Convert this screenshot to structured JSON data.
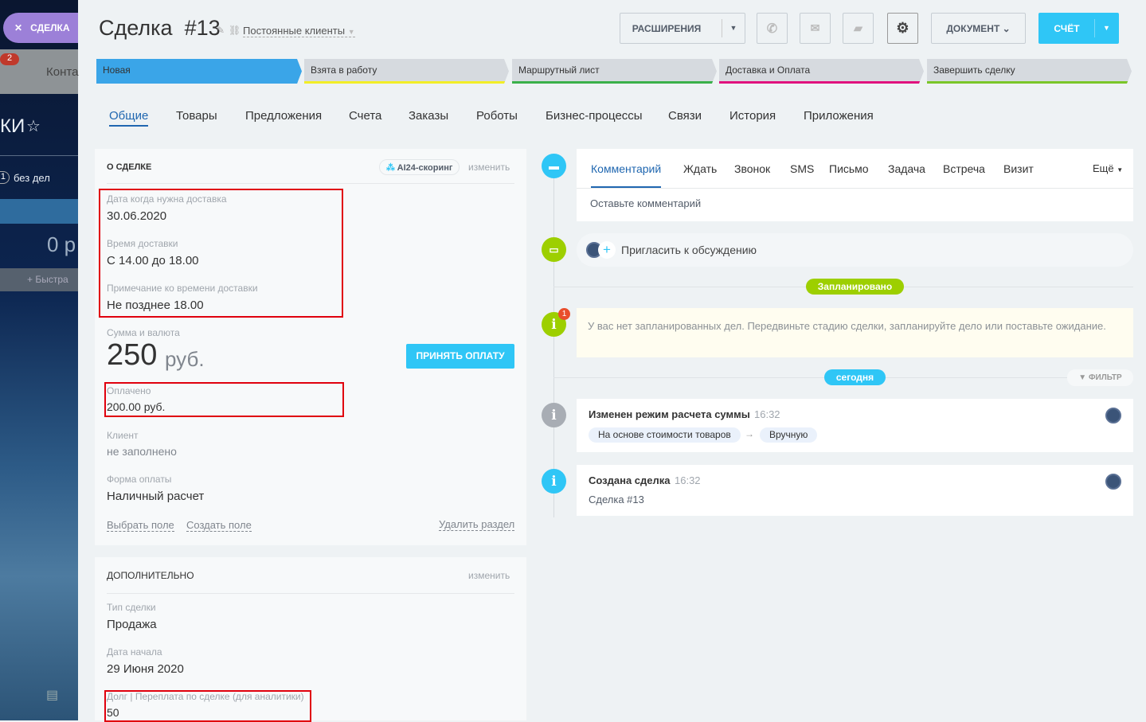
{
  "left_panel": {
    "deal_tab": "СДЕЛКА",
    "badge": "2",
    "contacts": "Конта",
    "title_fragment": "КИ",
    "counter": "1",
    "no_tasks": "без дел",
    "amount": "0 р",
    "quick": "Быстра"
  },
  "header": {
    "title": "Сделка",
    "number": "#13",
    "category": "Постоянные клиенты"
  },
  "toolbar": {
    "extensions": "РАСШИРЕНИЯ",
    "document": "ДОКУМЕНТ",
    "invoice": "СЧЁТ"
  },
  "stages": [
    {
      "label": "Новая",
      "color": "#3aa5e8"
    },
    {
      "label": "Взята в работу",
      "color": "#f2ee26"
    },
    {
      "label": "Маршрутный лист",
      "color": "#3ab04a"
    },
    {
      "label": "Доставка и Оплата",
      "color": "#e0127e"
    },
    {
      "label": "Завершить сделку",
      "color": "#7ac628"
    }
  ],
  "tabs": [
    "Общие",
    "Товары",
    "Предложения",
    "Счета",
    "Заказы",
    "Роботы",
    "Бизнес-процессы",
    "Связи",
    "История",
    "Приложения"
  ],
  "about": {
    "title": "О СДЕЛКЕ",
    "scoring": "AI24-скоринг",
    "edit": "изменить",
    "delivery_date_label": "Дата когда нужна доставка",
    "delivery_date": "30.06.2020",
    "delivery_time_label": "Время доставки",
    "delivery_time": "С 14.00 до 18.00",
    "note_label": "Примечание ко времени доставки",
    "note": "Не позднее 18.00",
    "sum_label": "Сумма и валюта",
    "sum": "250",
    "currency": "руб.",
    "accept_payment": "ПРИНЯТЬ ОПЛАТУ",
    "paid_label": "Оплачено",
    "paid": "200.00 руб.",
    "client_label": "Клиент",
    "client": "не заполнено",
    "payment_form_label": "Форма оплаты",
    "payment_form": "Наличный расчет",
    "select_field": "Выбрать поле",
    "create_field": "Создать поле",
    "delete_section": "Удалить раздел"
  },
  "extra": {
    "title": "ДОПОЛНИТЕЛЬНО",
    "edit": "изменить",
    "type_label": "Тип сделки",
    "type": "Продажа",
    "start_label": "Дата начала",
    "start": "29 Июня 2020",
    "debt_label": "Долг | Переплата по сделке (для аналитики)",
    "debt": "50"
  },
  "timeline": {
    "tabs": [
      "Комментарий",
      "Ждать",
      "Звонок",
      "SMS",
      "Письмо",
      "Задача",
      "Встреча",
      "Визит"
    ],
    "more": "Ещё",
    "comment_placeholder": "Оставьте комментарий",
    "invite": "Пригласить к обсуждению",
    "planned": "Запланировано",
    "badge": "1",
    "no_tasks": "У вас нет запланированных дел. Передвиньте стадию сделки, запланируйте дело или поставьте ожидание.",
    "today": "сегодня",
    "filter": "ФИЛЬТР",
    "events": [
      {
        "title": "Изменен режим расчета суммы",
        "time": "16:32",
        "from": "На основе стоимости товаров",
        "to": "Вручную"
      },
      {
        "title": "Создана сделка",
        "time": "16:32",
        "text": "Сделка #13"
      }
    ]
  }
}
